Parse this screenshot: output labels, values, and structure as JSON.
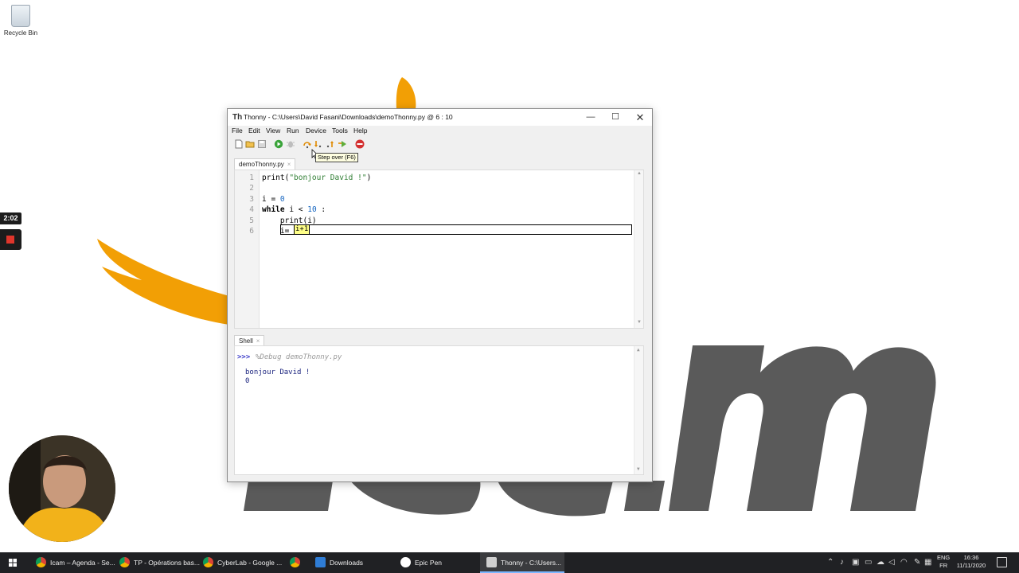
{
  "desktop": {
    "recycle_bin_label": "Recycle Bin",
    "recording_time": "2:02"
  },
  "window": {
    "title": "Thonny  -  C:\\Users\\David Fasani\\Downloads\\demoThonny.py  @  6 : 10",
    "minimize_glyph": "—",
    "maximize_glyph": "☐",
    "close_glyph": "✕"
  },
  "menu": [
    "File",
    "Edit",
    "View",
    "Run",
    "Device",
    "Tools",
    "Help"
  ],
  "toolbar": {
    "tooltip": "Step over (F6)",
    "icons": [
      "new-file-icon",
      "open-file-icon",
      "save-icon",
      "run-icon",
      "debug-icon",
      "step-over-icon",
      "step-into-icon",
      "step-out-icon",
      "resume-icon",
      "stop-icon"
    ]
  },
  "editor": {
    "tab_label": "demoThonny.py",
    "tab_close": "×",
    "line_numbers": [
      "1",
      "2",
      "3",
      "4",
      "5",
      "6"
    ],
    "lines": [
      "print(\"bonjour David !\")",
      "",
      "i = 0",
      "while i < 10 :",
      "    print(i)",
      "    i= i+1"
    ],
    "debug_expression": "i+1"
  },
  "shell": {
    "tab_label": "Shell",
    "tab_close": "×",
    "prompt": ">>>",
    "command": "%Debug demoThonny.py",
    "output": [
      "bonjour David !",
      "0"
    ]
  },
  "taskbar": {
    "items": [
      {
        "label": "Icam – Agenda - Se...",
        "icon": "chrome-icon"
      },
      {
        "label": "TP - Opérations bas...",
        "icon": "chrome-icon"
      },
      {
        "label": "CyberLab - Google ...",
        "icon": "chrome-icon"
      },
      {
        "label": "",
        "icon": "chrome-icon"
      },
      {
        "label": "Downloads",
        "icon": "download-icon"
      },
      {
        "label": "Epic Pen",
        "icon": "pen-icon"
      },
      {
        "label": "Thonny  -  C:\\Users...",
        "icon": "thonny-icon"
      }
    ],
    "language": "ENG",
    "layout": "FR",
    "time": "16:36",
    "date": "11/11/2020"
  },
  "colors": {
    "accent": "#f29f05",
    "logo_gray": "#5a5a5a",
    "taskbar": "#202124"
  }
}
